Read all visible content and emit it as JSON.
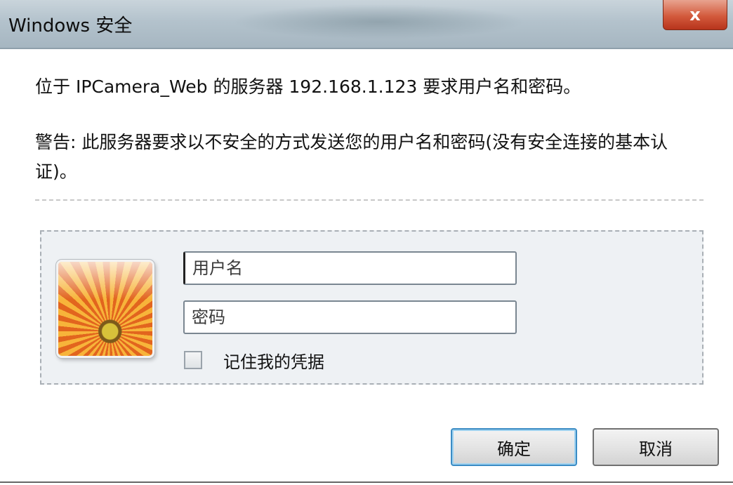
{
  "window": {
    "title": "Windows 安全",
    "close_label": "x"
  },
  "dialog": {
    "message": "位于 IPCamera_Web 的服务器 192.168.1.123 要求用户名和密码。",
    "warning": "警告: 此服务器要求以不安全的方式发送您的用户名和密码(没有安全连接的基本认证)。"
  },
  "credentials": {
    "username_placeholder": "用户名",
    "password_placeholder": "密码",
    "remember_label": "记住我的凭据",
    "remember_checked": false
  },
  "buttons": {
    "ok_label": "确定",
    "cancel_label": "取消"
  },
  "colors": {
    "titlebar": "#b3c2cc",
    "close_button": "#d35a3c",
    "panel_background": "#eef1f4",
    "default_button_border": "#3c8cc4"
  },
  "icons": {
    "user_avatar": "flower-picture-icon",
    "close": "close-icon"
  }
}
